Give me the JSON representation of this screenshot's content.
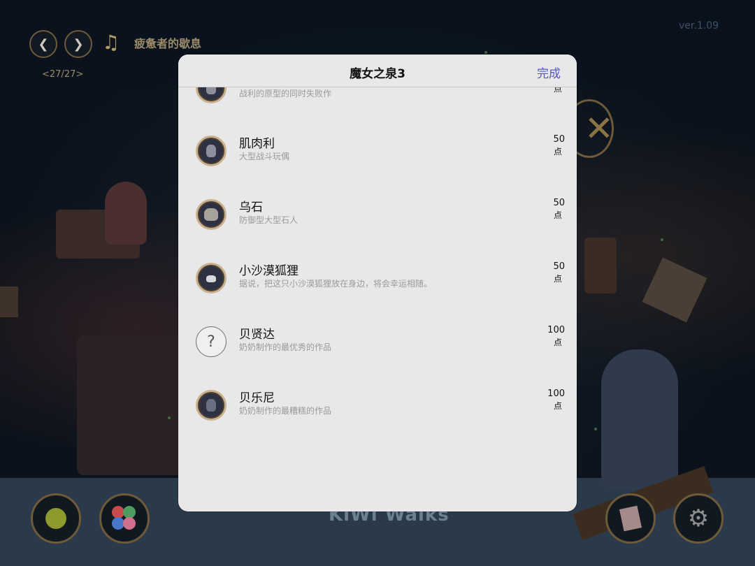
{
  "header": {
    "song_title": "疲惫者的歇息",
    "page_counter": "<27/27>",
    "version": "ver.1.09"
  },
  "brand": "KiWi Walks",
  "modal": {
    "title": "魔女之泉3",
    "done_label": "完成",
    "items": [
      {
        "name": "",
        "desc": "战利的原型的同时失败作",
        "points": "",
        "unit": "点",
        "icon": "doll-icon"
      },
      {
        "name": "肌肉利",
        "desc": "大型战斗玩偶",
        "points": "50",
        "unit": "点",
        "icon": "doll-icon"
      },
      {
        "name": "乌石",
        "desc": "防御型大型石人",
        "points": "50",
        "unit": "点",
        "icon": "golem-icon"
      },
      {
        "name": "小沙漠狐狸",
        "desc": "据说，把这只小沙漠狐狸放在身边，将会幸运相随。",
        "points": "50",
        "unit": "点",
        "icon": "fox-icon"
      },
      {
        "name": "贝贤达",
        "desc": "奶奶制作的最优秀的作品",
        "points": "100",
        "unit": "点",
        "icon": "question-icon"
      },
      {
        "name": "贝乐尼",
        "desc": "奶奶制作的最糟糕的作品",
        "points": "100",
        "unit": "点",
        "icon": "doll-icon"
      }
    ]
  }
}
